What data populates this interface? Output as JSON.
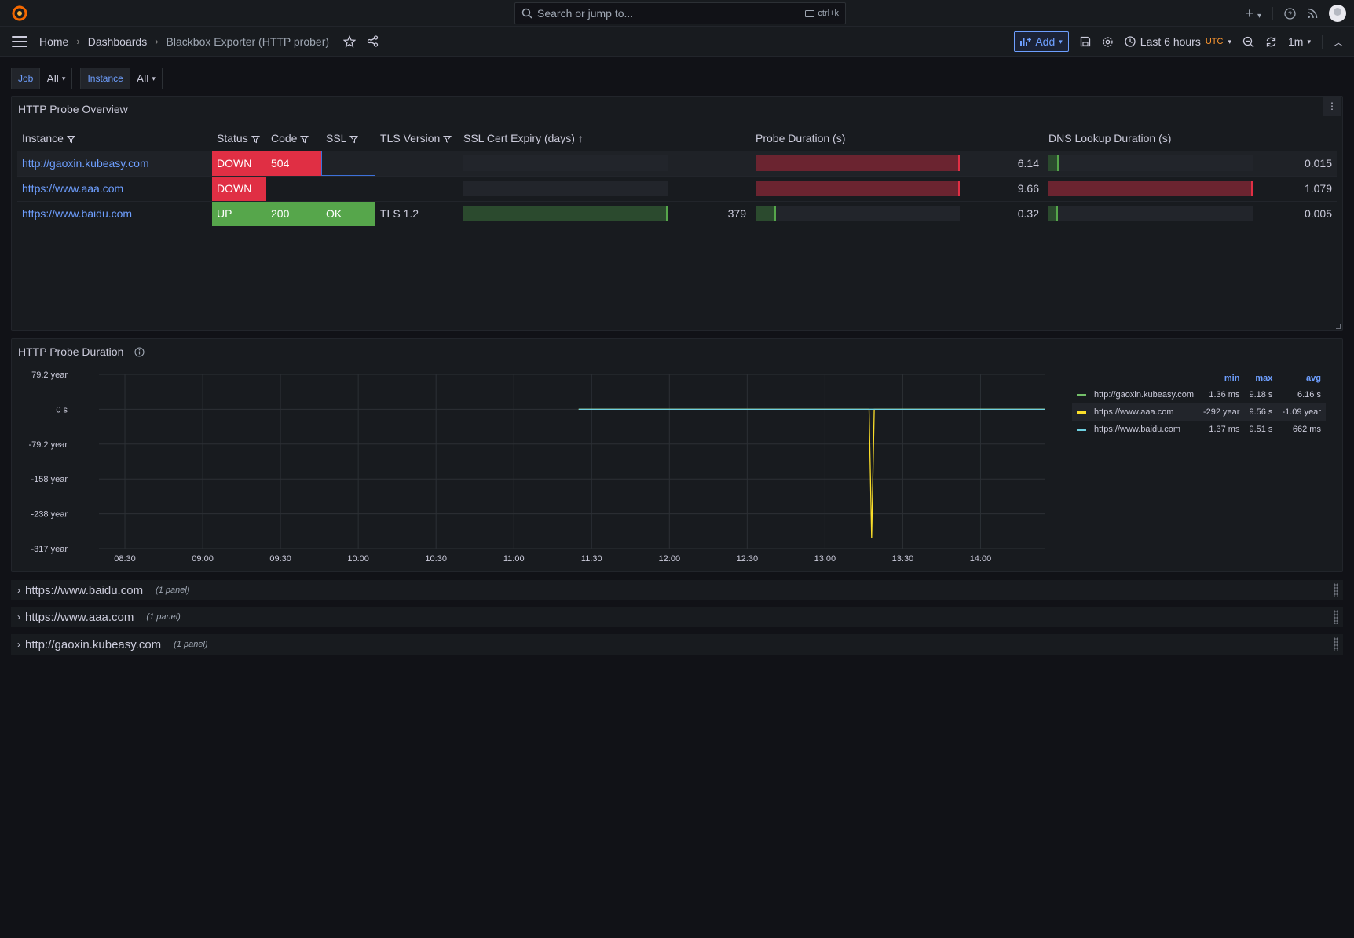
{
  "search": {
    "placeholder": "Search or jump to...",
    "shortcut": "ctrl+k"
  },
  "breadcrumbs": [
    "Home",
    "Dashboards",
    "Blackbox Exporter (HTTP prober)"
  ],
  "toolbar": {
    "add_label": "Add",
    "time_range": "Last 6 hours",
    "timezone": "UTC",
    "refresh": "1m"
  },
  "variables": [
    {
      "label": "Job",
      "value": "All"
    },
    {
      "label": "Instance",
      "value": "All"
    }
  ],
  "overview": {
    "title": "HTTP Probe Overview",
    "columns": [
      "Instance",
      "Status",
      "Code",
      "SSL",
      "TLS Version",
      "SSL Cert Expiry (days)",
      "Probe Duration (s)",
      "DNS Lookup Duration (s)"
    ],
    "rows": [
      {
        "instance": "http://gaoxin.kubeasy.com",
        "status": "DOWN",
        "code": "504",
        "ssl": "",
        "tls": "",
        "expiry": "",
        "expiry_frac": 0,
        "probe": "6.14",
        "probe_frac": 1.0,
        "dns": "0.015",
        "dns_frac": 0.05
      },
      {
        "instance": "https://www.aaa.com",
        "status": "DOWN",
        "code": "",
        "ssl": "",
        "tls": "",
        "expiry": "",
        "expiry_frac": 0,
        "probe": "9.66",
        "probe_frac": 1.0,
        "dns": "1.079",
        "dns_frac": 1.0
      },
      {
        "instance": "https://www.baidu.com",
        "status": "UP",
        "code": "200",
        "ssl": "OK",
        "tls": "TLS 1.2",
        "expiry": "379",
        "expiry_frac": 1.0,
        "probe": "0.32",
        "probe_frac": 0.1,
        "dns": "0.005",
        "dns_frac": 0.01
      }
    ],
    "colors": {
      "red": "#e02f44",
      "green": "#56a64b",
      "link": "#6e9fff"
    }
  },
  "duration_panel": {
    "title": "HTTP Probe Duration",
    "y_ticks": [
      "79.2 year",
      "0 s",
      "-79.2 year",
      "-158 year",
      "-238 year",
      "-317 year"
    ],
    "x_ticks": [
      "08:30",
      "09:00",
      "09:30",
      "10:00",
      "10:30",
      "11:00",
      "11:30",
      "12:00",
      "12:30",
      "13:00",
      "13:30",
      "14:00"
    ],
    "legend_headers": [
      "min",
      "max",
      "avg"
    ],
    "legend": [
      {
        "name": "http://gaoxin.kubeasy.com",
        "color": "#73bf69",
        "min": "1.36 ms",
        "max": "9.18 s",
        "avg": "6.16 s"
      },
      {
        "name": "https://www.aaa.com",
        "color": "#fade2a",
        "min": "-292 year",
        "max": "9.56 s",
        "avg": "-1.09 year"
      },
      {
        "name": "https://www.baidu.com",
        "color": "#6ed0e0",
        "min": "1.37 ms",
        "max": "9.51 s",
        "avg": "662 ms"
      }
    ]
  },
  "chart_data": {
    "type": "line",
    "x_range": [
      "08:20",
      "14:25"
    ],
    "ylim": [
      -317,
      79.2
    ],
    "yunit": "year",
    "series": [
      {
        "name": "http://gaoxin.kubeasy.com",
        "x": [
          "11:25",
          "14:25"
        ],
        "y": [
          0,
          0
        ]
      },
      {
        "name": "https://www.aaa.com",
        "x": [
          "11:25",
          "13:17",
          "13:18",
          "13:19",
          "14:25"
        ],
        "y": [
          0,
          0,
          -292,
          0,
          0
        ]
      },
      {
        "name": "https://www.baidu.com",
        "x": [
          "11:25",
          "14:25"
        ],
        "y": [
          0,
          0
        ]
      }
    ]
  },
  "rows": [
    {
      "title": "https://www.baidu.com",
      "count": "(1 panel)"
    },
    {
      "title": "https://www.aaa.com",
      "count": "(1 panel)"
    },
    {
      "title": "http://gaoxin.kubeasy.com",
      "count": "(1 panel)"
    }
  ]
}
